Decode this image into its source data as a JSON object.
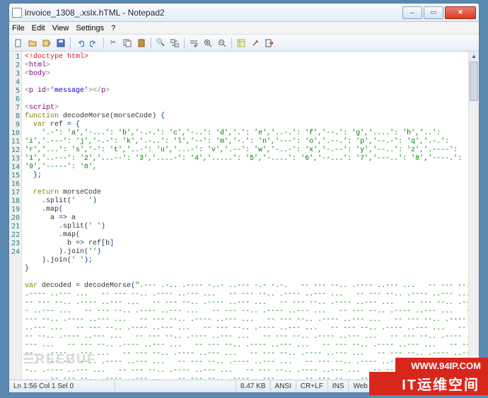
{
  "window": {
    "title": "invoice_1308_.xslx.hTML - Notepad2"
  },
  "menu": {
    "file": "File",
    "edit": "Edit",
    "view": "View",
    "settings": "Settings",
    "help": "?"
  },
  "status": {
    "pos": "Ln 1:56  Col 1  Sel 0",
    "size": "8.47 KB",
    "enc": "ANSI",
    "eol": "CR+LF",
    "ins": "INS",
    "lang": "Web Source Code"
  },
  "code": {
    "l1_a": "<!",
    "l1_b": "doctype html",
    "l1_c": ">",
    "l2_a": "<",
    "l2_b": "html",
    "l2_c": ">",
    "l3_a": "<",
    "l3_b": "body",
    "l3_c": ">",
    "l4": "",
    "l5_a": "<",
    "l5_b": "p id",
    "l5_c": "=",
    "l5_d": "'message'",
    "l5_e": "></",
    "l5_f": "p",
    "l5_g": ">",
    "l6": "",
    "l7_a": "<",
    "l7_b": "script",
    "l7_c": ">",
    "l8_a": "function",
    "l8_b": " decodeMorse",
    "l8_c": "(",
    "l8_d": "morseCode",
    "l8_e": ")",
    " l8_f": " {",
    "l9_a": "  var",
    "l9_b": " ref ",
    "l9_c": "=",
    "l9_d": " {",
    "l10": "    '.-': 'a','-...': 'b','-.-.': 'c','-..': 'd','.': 'e','..-.': 'f','--.': 'g','....': 'h','..': 'i','.---': 'j','-.-': 'k','.-..': 'l','--': 'm','-.': 'n','---': 'o','.--.': 'p','--.-': 'q','.-.': 'r','...': 's','-': 't','..-': 'u','...-': 'v','.--': 'w','-..-': 'x','-.--': 'y','--..': 'z','.----': '1','..---': '2','...--': '3','....-': '4','.....': '5','-....': '6','--...': '7','---..': '8','----.': '9','-----': '0',",
    "l11": "  };",
    "l12": "",
    "l13_a": "  return",
    "l13_b": " morseCode",
    "l14_a": "    .split",
    "l14_b": "(",
    "l14_c": "'   '",
    "l14_d": ")",
    "l15_a": "    .map",
    "l15_b": "(",
    "l16_a": "      a ",
    "l16_b": "=>",
    "l16_c": " a",
    "l17_a": "        .split",
    "l17_b": "(",
    "l17_c": "' '",
    "l17_d": ")",
    "l18_a": "        .map",
    "l18_b": "(",
    "l19_a": "          b ",
    "l19_b": "=>",
    "l19_c": " ref",
    "l19_d": "[",
    "l19_e": "b",
    "l19_f": "]",
    "l20_a": "        ).join",
    "l20_b": "(",
    "l20_c": "''",
    "l20_d": ")",
    "l21_a": "    ).join",
    "l21_b": "(",
    "l21_c": "' '",
    "l21_d": ");",
    "l22": "}",
    "l23": "",
    "l24_a": "var",
    "l24_b": " decoded ",
    "l24_c": "=",
    "l24_d": " decodeMorse",
    "l24_e": "(",
    "l24_f": "\""
  },
  "morse": ".--- .-.. .---- -..- ..--- -.- -.-.   -- --- --.. .---- ..--- ...   -- --- --.. .---- ..--- ...   -- --- --.. .---- ..--- ...   -- --- --.. .---- ..--- ...   -- --- --.. .---- ..--- ...   -- --- --.. .---- ..--- ...   -- --- --.. .---- ..--- ...   -- --- --.. .---- ..--- ...   -- --- --.. .---- ..--- ...   -- --- --.. .---- ..--- ...   -- --- --.. .---- ..--- ...   -- --- --.. .---- ..--- ...   -- --- --.. .---- ..--- ...   -- --- --.. .---- ..--- ...   -- --- --.. .---- ..--- ...   -- --- --.. .---- ..--- ...   -- --- --.. .---- ..--- ...   -- --- --.. .---- ..--- ...   -- --- --.. .---- ..--- ...   -- --- --.. .---- ..--- ...   -- --- --.. .---- ..--- ...   -- --- --.. .---- ..--- ...   -- --- --.. .---- ..--- ...   -- --- --.. .---- ..--- ...   -- --- --.. .---- ..--- ...   -- --- --.. .---- ..--- ...   -- --- --.. .---- ..--- ...   -- --- --.. .---- ..--- ...   -- --- --.. .---- ..--- ...   -- --- --.. .---- ..--- ...   -- --- --.. .---- ..--- ...   -- --- --.. .---- ..--- ...   -- --- --.. .---- ..--- ...   -- --- --.. .---- ..--- ...   -- --- --.. .---- ..--- ...   -- --- --.. .---- ..--- ...   -- --- --.. .---- ..--- ...   -- --- --.. .---- ..--- ...   -- --- --.. .---- ..--- ...   -- --- --.. .---- ..--- ...   -- --- --.. .---- ..--- ...   -- --- --.. .---- ..--- ...   -- --- --.. .---- ..--- ...   -- --- --.. .---- ..--- ...   -- --- --.. .---- ..--- ...   -- --- --.. .---- ..--- ...",
  "watermark": {
    "logo": "☰REEBUF",
    "url": "WWW.94IP.COM",
    "brand": "IT运维空间"
  }
}
